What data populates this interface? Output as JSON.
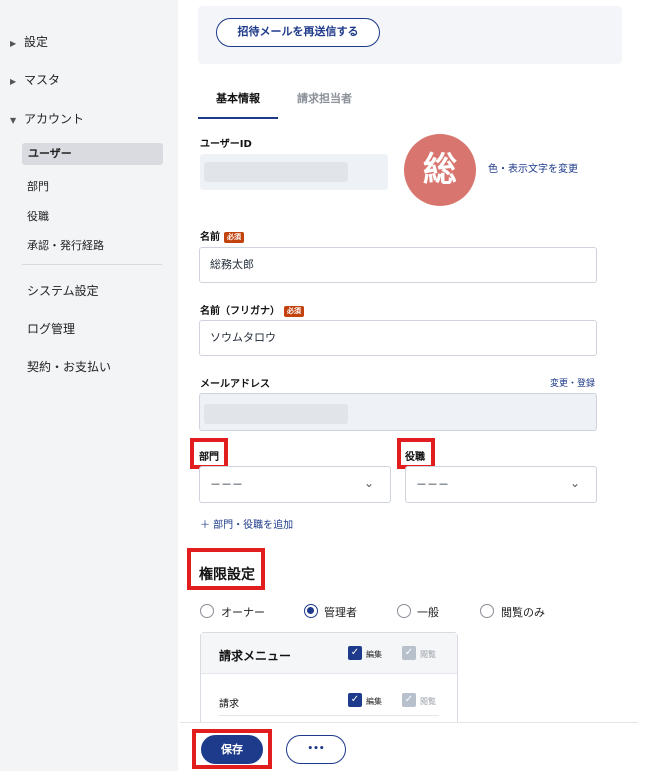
{
  "sidebar": {
    "top_items": [
      {
        "label": "設定",
        "expanded": false
      },
      {
        "label": "マスタ",
        "expanded": false
      },
      {
        "label": "アカウント",
        "expanded": true
      }
    ],
    "account_items": [
      {
        "label": "ユーザー",
        "active": true
      },
      {
        "label": "部門"
      },
      {
        "label": "役職"
      },
      {
        "label": "承認・発行経路"
      }
    ],
    "main_items": [
      {
        "label": "システム設定"
      },
      {
        "label": "ログ管理"
      },
      {
        "label": "契約・お支払い"
      }
    ]
  },
  "invite": {
    "resend_label": "招待メールを再送信する"
  },
  "tabs": [
    {
      "label": "基本情報",
      "active": true
    },
    {
      "label": "請求担当者",
      "active": false
    }
  ],
  "form": {
    "user_id_label": "ユーザーID",
    "avatar_char": "総",
    "avatar_color": "#d9756f",
    "change_color_link": "色・表示文字を変更",
    "required_badge": "必須",
    "name_label": "名前",
    "name_value": "総務太郎",
    "kana_label": "名前（フリガナ）",
    "kana_value": "ソウムタロウ",
    "email_label": "メールアドレス",
    "email_link": "変更・登録",
    "dept_label": "部門",
    "dept_value": "－－－",
    "position_label": "役職",
    "position_value": "－－－",
    "add_dept_link": "＋ 部門・役職を追加"
  },
  "permissions": {
    "heading": "権限設定",
    "roles": [
      {
        "label": "オーナー",
        "selected": false
      },
      {
        "label": "管理者",
        "selected": true
      },
      {
        "label": "一般",
        "selected": false
      },
      {
        "label": "閲覧のみ",
        "selected": false
      }
    ],
    "menu_header": "請求メニュー",
    "edit_label": "編集",
    "view_label": "閲覧",
    "rows": [
      {
        "label": "請求",
        "edit": true,
        "view": true
      }
    ]
  },
  "footer": {
    "save_label": "保存",
    "more_label": "•••"
  },
  "colors": {
    "accent": "#1e3a8a",
    "highlight": "#e11d1d",
    "required": "#c2410c"
  }
}
